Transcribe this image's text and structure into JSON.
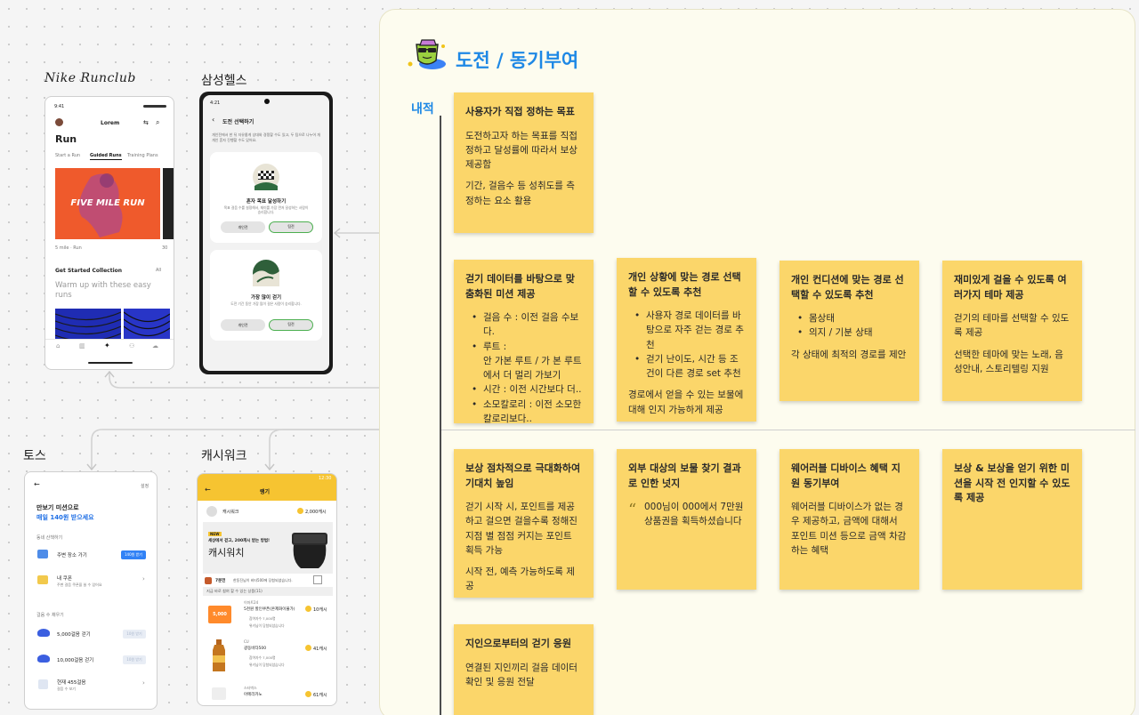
{
  "board": {
    "title": "도전 / 동기부여",
    "row_label": "내적"
  },
  "apps": {
    "nike": {
      "label": "Nike Runclub",
      "time": "9:41",
      "header": "Lorem",
      "heading": "Run",
      "tabs": [
        "Start a Run",
        "Guided Runs",
        "Training Plans"
      ],
      "hero_text": "FIVE MILE RUN",
      "hero_meta": "5 mile · Run",
      "hero_meta_right": "30",
      "section_title": "Get Started Collection",
      "section_link": "All",
      "section_sub": "Warm up with these easy runs"
    },
    "samsung": {
      "label": "삼성헬스",
      "time": "4:21",
      "header": "도전 선택하기",
      "intro": "개인전에서 한 뒤 자유롭게 상대와 경쟁할 수도 있고, 두 팀으로 나누어 개개인 혼자 진행할 수도 있어요.",
      "card1_title": "혼자 목표 달성하기",
      "card1_desc": "목표 걸음 수를 설정해서, 재미를 가장 먼저 달성하는 사람이 승리합니다.",
      "card2_title": "가장 많이 걷기",
      "card2_desc": "도전 기간 동안 가장 많이 걸은 사람이 승리합니다.",
      "btn_left": "개인전",
      "btn_right": "팀전"
    },
    "toss": {
      "label": "토스",
      "top_right": "설정",
      "headline1": "만보기 미션으로",
      "headline2": "매일 140원 받으세요",
      "section1": "동네 산책하기",
      "item1": "주변 장소 가기",
      "item1_btn": "140원 받기",
      "item2": "내 쿠폰",
      "item2_sub": "주변 걸음 쿠폰을 쓸 수 있어요",
      "section2": "걸음 수 채우기",
      "step1": "5,000걸음 걷기",
      "step2": "10,000걸음 걷기",
      "step_btn": "10원 받기",
      "step3": "현재 455걸음",
      "step3_sub": "걸음 수 보기"
    },
    "cashwalk": {
      "label": "캐시워크",
      "time": "12:30",
      "header": "랭기",
      "brand": "캐시워크",
      "points": "2,000캐시",
      "banner_tag": "NEW",
      "banner_text": "세상에서 걷고, 200캐시 받는 방법!",
      "banner_big": "캐시워치",
      "notice_count": "7분전",
      "notice_text": "한동진님이 비타500에 당첨되셨습니다.",
      "list_header": "지금 바로 참여 할 수 있는 상품(11)",
      "items": [
        {
          "brand": "이마트24",
          "name": "5천원 할인쿠폰(온제화이불가)",
          "price": "10캐시",
          "count": "참여자수 7,000명",
          "winner": "위키님이 당첨되셨습니다"
        },
        {
          "brand": "CU",
          "name": "광동비타500",
          "price": "41캐시",
          "count": "참여자수 7,000명",
          "winner": "위키님이 당첨되셨습니다"
        },
        {
          "brand": "스타벅스",
          "name": "아메리카노",
          "price": "61캐시",
          "count": "",
          "winner": ""
        }
      ],
      "coupon_text": "5,000"
    }
  },
  "stickies": [
    {
      "title": "사용자가 직접 정하는 목표",
      "paras": [
        "도전하고자 하는 목표를 직접 정하고 달성률에 따라서 보상 제공함",
        "기간, 걸음수 등 성취도를 측정하는 요소 활용"
      ]
    },
    {
      "title": "걷기 데이터를 바탕으로 맞춤화된 미션 제공",
      "bullets": [
        "걸음 수 : 이전 걸음 수보다.",
        "루트 :\n안 가본 루트 / 가 본 루트에서 더 멀리 가보기",
        "시간 : 이전 시간보다 더..",
        "소모칼로리 : 이전 소모한 칼로리보다.."
      ]
    },
    {
      "title": "개인 상황에 맞는 경로 선택할 수 있도록 추천",
      "bullets": [
        "사용자 경로 데이터를 바탕으로 자주 걷는 경로 추천",
        "걷기 난이도, 시간 등 조건이 다른 경로 set 추천"
      ],
      "paras": [
        "경로에서 얻을 수 있는 보물에 대해 인지 가능하게 제공"
      ]
    },
    {
      "title": "개인 컨디션에 맞는 경로 선택할 수 있도록 추천",
      "bullets": [
        "몸상태",
        "의지 / 기분 상태"
      ],
      "paras": [
        "각 상태에 최적의 경로를 제안"
      ]
    },
    {
      "title": "재미있게 걸을 수 있도록 여러가지 테마 제공",
      "paras": [
        "걷기의 테마를 선택할 수 있도록 제공",
        "선택한 테마에 맞는 노래, 음성안내, 스토리텔링 지원"
      ]
    },
    {
      "title": "보상 점차적으로 극대화하여 기대치 높임",
      "paras": [
        "걷기 시작 시, 포인트를 제공하고 걸으면 걸을수록 정해진 지점 별 점점 커지는 포인트 획득 가능",
        "시작 전, 예측 가능하도록 제공"
      ]
    },
    {
      "title": "외부 대상의 보물 찾기 결과로 인한 넛지",
      "quote": "000님이 000에서 7만원 상품권을 획득하셨습니다"
    },
    {
      "title": "웨어러블 디바이스 혜택 지원 동기부여",
      "paras": [
        "웨어러블 디바이스가 없는 경우 제공하고, 금액에 대해서 포인트 미션 등으로 금액 차감하는 혜택"
      ]
    },
    {
      "title": "보상 & 보상을 얻기 위한 미션을 시작 전 인지할 수 있도록 제공"
    },
    {
      "title": "지인으로부터의 걷기 응원",
      "paras": [
        "연결된 지인끼리 걸음 데이터 확인 및 응원 전달"
      ]
    }
  ]
}
